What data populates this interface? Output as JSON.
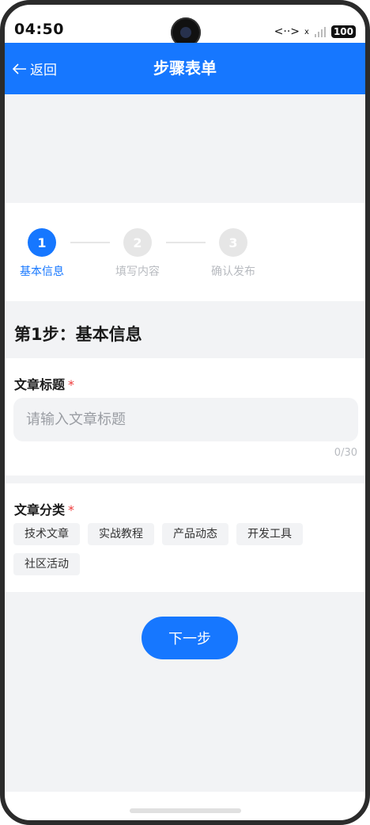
{
  "status": {
    "time": "04:50",
    "signal": "<··>",
    "x_mark": "x",
    "battery": "100"
  },
  "nav": {
    "back_label": "返回",
    "title": "步骤表单"
  },
  "steps": [
    {
      "number": "1",
      "label": "基本信息",
      "state": "active"
    },
    {
      "number": "2",
      "label": "填写内容",
      "state": "inactive"
    },
    {
      "number": "3",
      "label": "确认发布",
      "state": "inactive"
    }
  ],
  "section": {
    "title": "第1步：基本信息"
  },
  "title_field": {
    "label": "文章标题",
    "required": "*",
    "placeholder": "请输入文章标题",
    "value": "",
    "counter": "0/30"
  },
  "category_field": {
    "label": "文章分类",
    "required": "*",
    "options": [
      "技术文章",
      "实战教程",
      "产品动态",
      "开发工具",
      "社区活动"
    ]
  },
  "actions": {
    "next_label": "下一步"
  },
  "colors": {
    "primary": "#1677ff",
    "inactive_step": "#e6e6e6",
    "inactive_text": "#b8bbc0",
    "background": "#f2f3f5",
    "required": "#ee3b3b"
  }
}
